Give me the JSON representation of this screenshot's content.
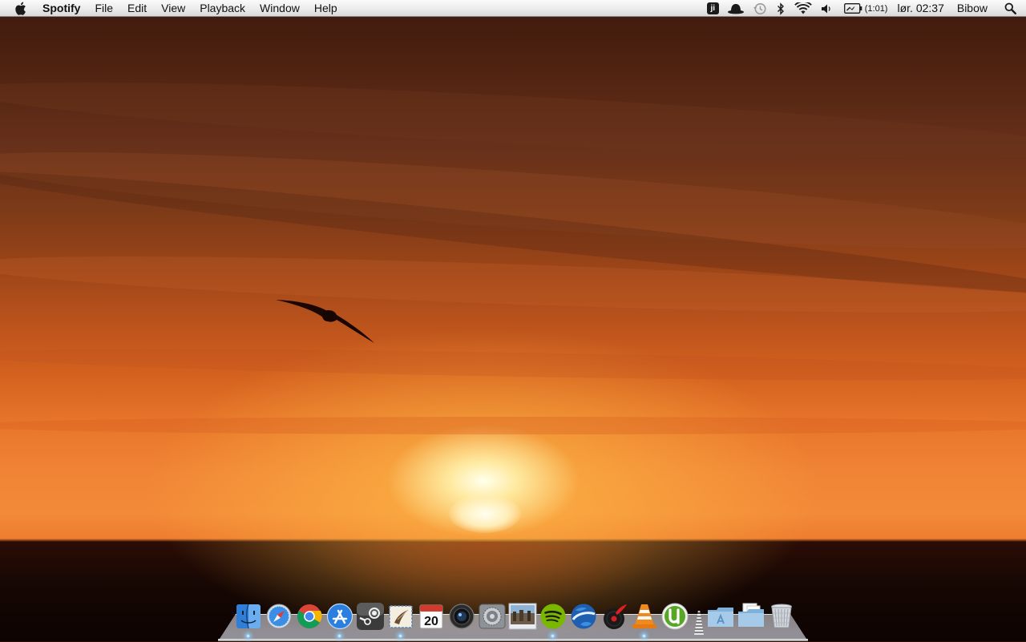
{
  "menubar": {
    "apple_icon": "apple-logo-icon",
    "app_name": "Spotify",
    "items": [
      "File",
      "Edit",
      "View",
      "Playback",
      "Window",
      "Help"
    ],
    "status": {
      "jingit_label": "ji",
      "battery_text": "(1:01)",
      "clock": "lør. 02:37",
      "user": "Bibow"
    }
  },
  "dock": {
    "calendar_day": "20",
    "apps": [
      {
        "name": "Finder",
        "icon": "finder-icon",
        "running": true
      },
      {
        "name": "Safari",
        "icon": "safari-icon",
        "running": false
      },
      {
        "name": "Google Chrome",
        "icon": "chrome-icon",
        "running": false
      },
      {
        "name": "App Store",
        "icon": "app-store-icon",
        "running": true
      },
      {
        "name": "Steam",
        "icon": "steam-icon",
        "running": false
      },
      {
        "name": "Mail",
        "icon": "mail-icon",
        "running": true
      },
      {
        "name": "Calendar",
        "icon": "calendar-icon",
        "running": false
      },
      {
        "name": "Photo Booth",
        "icon": "photo-booth-icon",
        "running": false
      },
      {
        "name": "System Preferences",
        "icon": "system-preferences-icon",
        "running": false
      },
      {
        "name": "Photos",
        "icon": "photo-stack-icon",
        "running": false
      },
      {
        "name": "Spotify",
        "icon": "spotify-icon",
        "running": true
      },
      {
        "name": "Google Earth",
        "icon": "google-earth-icon",
        "running": false
      },
      {
        "name": "Music Player",
        "icon": "record-icon",
        "running": false
      },
      {
        "name": "VLC",
        "icon": "vlc-cone-icon",
        "running": true
      },
      {
        "name": "uTorrent",
        "icon": "utorrent-icon",
        "running": false
      }
    ],
    "stacks": [
      {
        "name": "Applications",
        "icon": "applications-folder-icon"
      },
      {
        "name": "Documents",
        "icon": "documents-folder-icon"
      },
      {
        "name": "Trash",
        "icon": "trash-icon"
      }
    ]
  }
}
